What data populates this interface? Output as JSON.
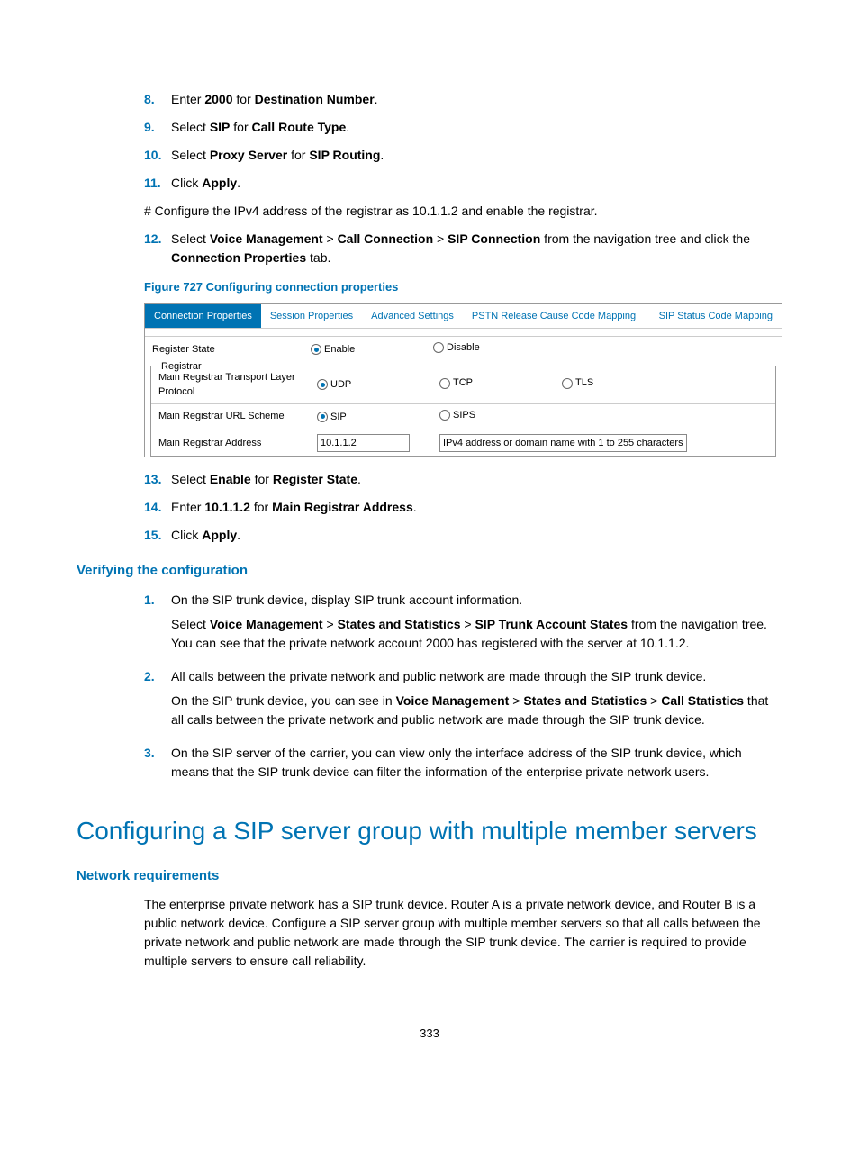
{
  "steps1": {
    "n8": "8.",
    "t8_a": "Enter ",
    "t8_b": "2000",
    "t8_c": " for ",
    "t8_d": "Destination Number",
    "t8_e": ".",
    "n9": "9.",
    "t9_a": "Select ",
    "t9_b": "SIP",
    "t9_c": " for ",
    "t9_d": "Call Route Type",
    "t9_e": ".",
    "n10": "10.",
    "t10_a": "Select ",
    "t10_b": "Proxy Server",
    "t10_c": " for ",
    "t10_d": "SIP Routing",
    "t10_e": ".",
    "n11": "11.",
    "t11_a": "Click ",
    "t11_b": "Apply",
    "t11_c": "."
  },
  "hash_line": "# Configure the IPv4 address of the registrar as 10.1.1.2 and enable the registrar.",
  "step12": {
    "n": "12.",
    "a": "Select ",
    "b": "Voice Management",
    "c": " > ",
    "d": "Call Connection",
    "e": " > ",
    "f": "SIP Connection",
    "g": " from the navigation tree and click the ",
    "h": "Connection Properties",
    "i": " tab."
  },
  "figure_caption": "Figure 727 Configuring connection properties",
  "figure": {
    "tabs": {
      "t0": "Connection Properties",
      "t1": "Session Properties",
      "t2": "Advanced Settings",
      "t3": "PSTN Release Cause Code Mapping",
      "t4": "SIP Status Code Mapping"
    },
    "register_state": "Register State",
    "enable": "Enable",
    "disable": "Disable",
    "registrar_legend": "Registrar",
    "transport_label": "Main Registrar Transport Layer Protocol",
    "udp": "UDP",
    "tcp": "TCP",
    "tls": "TLS",
    "url_scheme_label": "Main Registrar URL Scheme",
    "sip": "SIP",
    "sips": "SIPS",
    "addr_label": "Main Registrar Address",
    "addr_value": "10.1.1.2",
    "addr_hint": "IPv4 address or domain name with 1 to 255 characters"
  },
  "steps2": {
    "n13": "13.",
    "t13_a": "Select ",
    "t13_b": "Enable",
    "t13_c": " for ",
    "t13_d": "Register State",
    "t13_e": ".",
    "n14": "14.",
    "t14_a": "Enter ",
    "t14_b": "10.1.1.2",
    "t14_c": " for ",
    "t14_d": "Main Registrar Address",
    "t14_e": ".",
    "n15": "15.",
    "t15_a": "Click ",
    "t15_b": "Apply",
    "t15_c": "."
  },
  "verify_heading": "Verifying the configuration",
  "verify": {
    "n1": "1.",
    "v1a": "On the SIP trunk device, display SIP trunk account information.",
    "v1b_a": "Select ",
    "v1b_b": "Voice Management",
    "v1b_c": " > ",
    "v1b_d": "States and Statistics",
    "v1b_e": " > ",
    "v1b_f": "SIP Trunk Account States",
    "v1b_g": " from the navigation tree. You can see that the private network account 2000 has registered with the server at 10.1.1.2.",
    "n2": "2.",
    "v2a": "All calls between the private network and public network are made through the SIP trunk device.",
    "v2b_a": "On the SIP trunk device, you can see in ",
    "v2b_b": "Voice Management",
    "v2b_c": " > ",
    "v2b_d": "States and Statistics",
    "v2b_e": " > ",
    "v2b_f": "Call Statistics",
    "v2b_g": " that all calls between the private network and public network are made through the SIP trunk device.",
    "n3": "3.",
    "v3": "On the SIP server of the carrier, you can view only the interface address of the SIP trunk device, which means that the SIP trunk device can filter the information of the enterprise private network users."
  },
  "main_heading": "Configuring a SIP server group with multiple member servers",
  "netreq_heading": "Network requirements",
  "netreq_body": "The enterprise private network has a SIP trunk device. Router A is a private network device, and Router B is a public network device. Configure a SIP server group with multiple member servers so that all calls between the private network and public network are made through the SIP trunk device. The carrier is required to provide multiple servers to ensure call reliability.",
  "page_number": "333"
}
